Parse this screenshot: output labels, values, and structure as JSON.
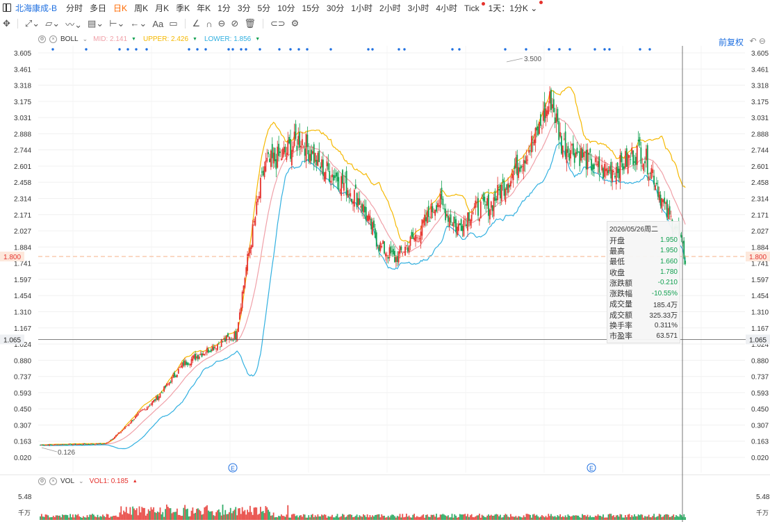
{
  "header": {
    "stock_name": "北海康成-B",
    "periods": [
      "分时",
      "多日",
      "日K",
      "周K",
      "月K",
      "季K",
      "年K",
      "1分",
      "3分",
      "5分",
      "10分",
      "15分",
      "30分",
      "1小时",
      "2小时",
      "3小时",
      "4小时",
      "Tick"
    ],
    "active_period": "日K",
    "period_combo": "1天：1分K"
  },
  "toolbar": {
    "text_tool": "Aa"
  },
  "indicators": {
    "boll": {
      "name": "BOLL",
      "mid_label": "MID:",
      "mid": "2.141",
      "upper_label": "UPPER:",
      "upper": "2.426",
      "lower_label": "LOWER:",
      "lower": "1.856"
    },
    "vol": {
      "name": "VOL",
      "vol1_label": "VOL1:",
      "vol1": "0.185"
    }
  },
  "fuquan": "前复权",
  "colors": {
    "up": "#e5322d",
    "down": "#11a050",
    "mid": "#f0a0a8",
    "upper": "#f5b800",
    "lower": "#31b0e0",
    "accent": "#1e6fe0"
  },
  "chart_data": {
    "type": "candlestick",
    "price_axis": {
      "min": 0.02,
      "max": 3.605,
      "ticks": [
        "3.605",
        "3.461",
        "3.318",
        "3.175",
        "3.031",
        "2.888",
        "2.744",
        "2.601",
        "2.458",
        "2.314",
        "2.171",
        "2.027",
        "1.884",
        "1.741",
        "1.597",
        "1.454",
        "1.310",
        "1.167",
        "1.024",
        "0.880",
        "0.737",
        "0.593",
        "0.450",
        "0.307",
        "0.163",
        "0.020"
      ]
    },
    "crosshair_price": "1.065",
    "last_price": "1.800",
    "annot_high": "3.500",
    "annot_low": "0.126",
    "event_marker": "E",
    "vol_axis": {
      "top": "5.48",
      "unit": "千万"
    }
  },
  "tooltip": {
    "date": "2026/05/26周二",
    "rows": [
      {
        "label": "开盘",
        "value": "1.950",
        "color": "#11a050"
      },
      {
        "label": "最高",
        "value": "1.950",
        "color": "#11a050"
      },
      {
        "label": "最低",
        "value": "1.660",
        "color": "#11a050"
      },
      {
        "label": "收盘",
        "value": "1.780",
        "color": "#11a050"
      },
      {
        "label": "涨跌额",
        "value": "-0.210",
        "color": "#11a050"
      },
      {
        "label": "涨跌幅",
        "value": "-10.55%",
        "color": "#11a050"
      },
      {
        "label": "成交量",
        "value": "185.4万",
        "color": "#333"
      },
      {
        "label": "成交额",
        "value": "325.33万",
        "color": "#333"
      },
      {
        "label": "换手率",
        "value": "0.311%",
        "color": "#333"
      },
      {
        "label": "市盈率",
        "value": "63.571",
        "color": "#333"
      }
    ]
  }
}
